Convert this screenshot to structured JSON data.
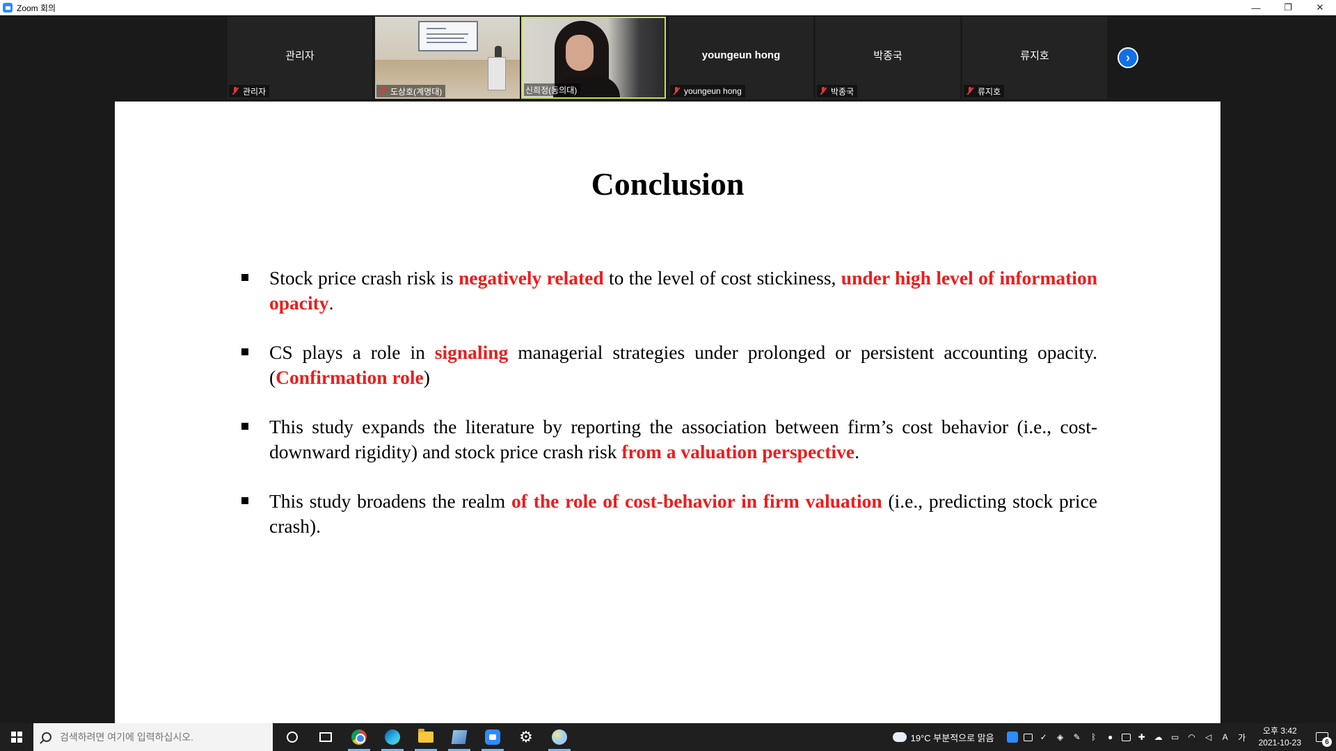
{
  "window": {
    "title": "Zoom 회의",
    "controls": {
      "minimize": "—",
      "restore": "❐",
      "close": "✕"
    }
  },
  "participants": [
    {
      "name": "관리자",
      "label": "관리자",
      "video": false,
      "name_bold": false
    },
    {
      "name": "",
      "label": "도상호(계명대)",
      "video": true,
      "scene": "classroom"
    },
    {
      "name": "",
      "label": "신희정(동의대)",
      "video": true,
      "scene": "webcam",
      "active_speaker": true
    },
    {
      "name": "youngeun hong",
      "label": "youngeun hong",
      "video": false,
      "name_bold": true
    },
    {
      "name": "박종국",
      "label": "박종국",
      "video": false,
      "name_bold": false
    },
    {
      "name": "류지호",
      "label": "류지호",
      "video": false,
      "name_bold": false
    }
  ],
  "strip": {
    "next_icon": "chevron-right-icon",
    "next_glyph": "›"
  },
  "slide": {
    "title": "Conclusion",
    "bullets": [
      {
        "segments": [
          {
            "text": "Stock price crash risk is ",
            "highlight": false
          },
          {
            "text": "negatively related",
            "highlight": true
          },
          {
            "text": " to the level of cost stickiness, ",
            "highlight": false
          },
          {
            "text": "under high level of information opacity",
            "highlight": true
          },
          {
            "text": ".",
            "highlight": false
          }
        ]
      },
      {
        "segments": [
          {
            "text": "CS plays a role in ",
            "highlight": false
          },
          {
            "text": "signaling",
            "highlight": true
          },
          {
            "text": " managerial strategies under prolonged or persistent accounting opacity. (",
            "highlight": false
          },
          {
            "text": "Confirmation role",
            "highlight": true
          },
          {
            "text": ")",
            "highlight": false
          }
        ]
      },
      {
        "segments": [
          {
            "text": "This study expands the literature by reporting the association between firm’s cost behavior (i.e., cost-downward rigidity) and stock price crash risk ",
            "highlight": false
          },
          {
            "text": "from a valuation perspective",
            "highlight": true
          },
          {
            "text": ".",
            "highlight": false
          }
        ]
      },
      {
        "segments": [
          {
            "text": "This study broadens the realm ",
            "highlight": false
          },
          {
            "text": "of the role of cost-behavior in firm valuation",
            "highlight": true
          },
          {
            "text": " (i.e., predicting stock price crash).",
            "highlight": false
          }
        ]
      }
    ],
    "highlight_color": "#ee1c1c"
  },
  "taskbar": {
    "search_placeholder": "검색하려면 여기에 입력하십시오.",
    "apps": [
      {
        "name": "cortana-icon"
      },
      {
        "name": "task-view-icon"
      },
      {
        "name": "chrome-icon",
        "running": true
      },
      {
        "name": "edge-icon",
        "running": true
      },
      {
        "name": "file-explorer-icon",
        "running": true
      },
      {
        "name": "notes-app-icon",
        "running": true
      },
      {
        "name": "zoom-icon",
        "running": true
      },
      {
        "name": "settings-gear-icon"
      },
      {
        "name": "paint-app-icon",
        "running": true
      }
    ],
    "weather": "19°C  부분적으로 맑음",
    "input_indicator": "A",
    "ime_indicator": "가",
    "time": "오후 3:42",
    "date": "2021-10-23",
    "notification_count": "6"
  },
  "colors": {
    "zoom_blue": "#2d8cff",
    "active_speaker_border": "#c8e04a",
    "background": "#1a1a1a"
  }
}
